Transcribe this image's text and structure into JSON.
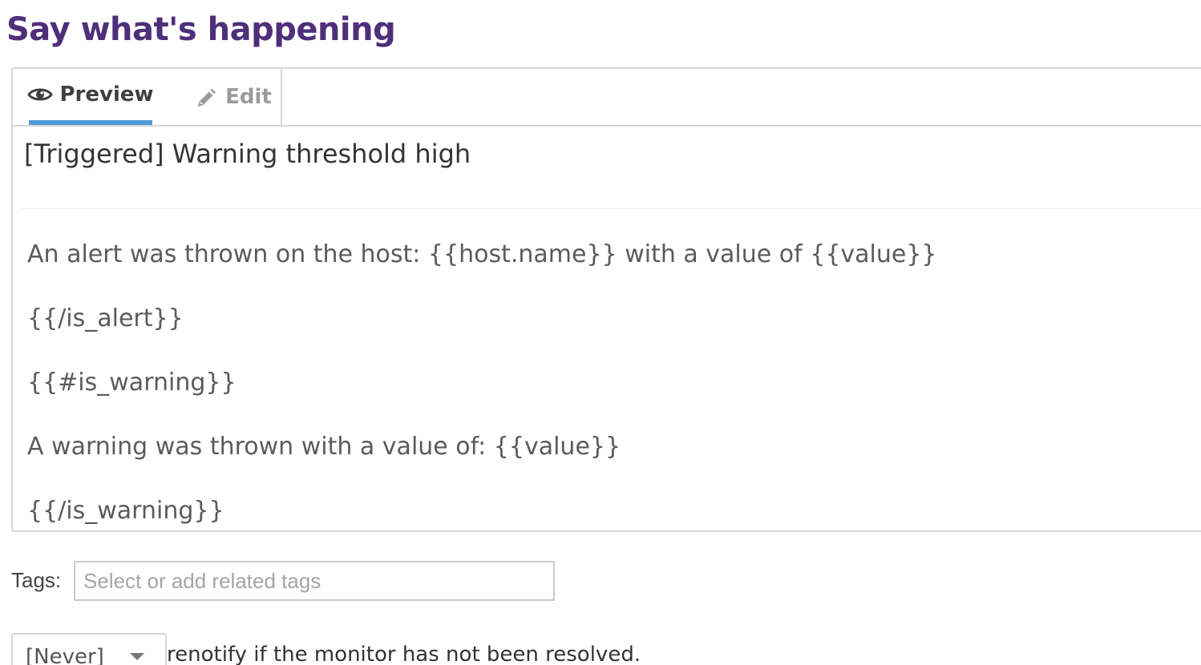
{
  "header": {
    "title": "Say what's happening"
  },
  "editor": {
    "tabs": [
      {
        "label": "Preview",
        "icon": "eye-icon",
        "active": true
      },
      {
        "label": "Edit",
        "icon": "pencil-icon",
        "active": false
      }
    ],
    "subject": "[Triggered] Warning threshold high",
    "body_lines": [
      "An alert was thrown on the host: {{host.name}} with a value of {{value}}",
      "{{/is_alert}}",
      "{{#is_warning}}",
      "A warning was thrown with a value of: {{value}}",
      "{{/is_warning}}"
    ]
  },
  "tags": {
    "label": "Tags:",
    "placeholder": "Select or add related tags",
    "value": ""
  },
  "renotify": {
    "selected": "[Never]",
    "icon": "caret-down-icon",
    "text": "renotify if the monitor has not been resolved."
  },
  "colors": {
    "title": "#4f2f7a",
    "active_tab_indicator": "#4d9bd7",
    "border": "#d7d7d7"
  }
}
